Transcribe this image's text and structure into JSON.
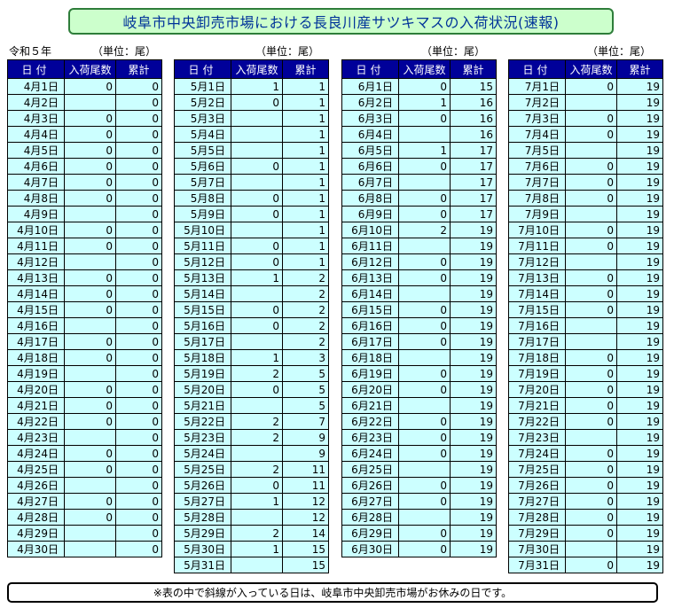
{
  "title": "岐阜市中央卸売市場における長良川産サツキマスの入荷状況(速報)",
  "era": "令和５年",
  "unit_label": "（単位：尾）",
  "headers": {
    "date": "日付",
    "arrivals": "入荷尾数",
    "cumulative": "累計"
  },
  "months": [
    {
      "rows": [
        {
          "date": "4月1日",
          "n": "0",
          "cum": "0"
        },
        {
          "date": "4月2日",
          "n": null,
          "cum": "0"
        },
        {
          "date": "4月3日",
          "n": "0",
          "cum": "0"
        },
        {
          "date": "4月4日",
          "n": "0",
          "cum": "0"
        },
        {
          "date": "4月5日",
          "n": "0",
          "cum": "0"
        },
        {
          "date": "4月6日",
          "n": "0",
          "cum": "0"
        },
        {
          "date": "4月7日",
          "n": "0",
          "cum": "0"
        },
        {
          "date": "4月8日",
          "n": "0",
          "cum": "0"
        },
        {
          "date": "4月9日",
          "n": null,
          "cum": "0"
        },
        {
          "date": "4月10日",
          "n": "0",
          "cum": "0"
        },
        {
          "date": "4月11日",
          "n": "0",
          "cum": "0"
        },
        {
          "date": "4月12日",
          "n": null,
          "cum": "0"
        },
        {
          "date": "4月13日",
          "n": "0",
          "cum": "0"
        },
        {
          "date": "4月14日",
          "n": "0",
          "cum": "0"
        },
        {
          "date": "4月15日",
          "n": "0",
          "cum": "0"
        },
        {
          "date": "4月16日",
          "n": null,
          "cum": "0"
        },
        {
          "date": "4月17日",
          "n": "0",
          "cum": "0"
        },
        {
          "date": "4月18日",
          "n": "0",
          "cum": "0"
        },
        {
          "date": "4月19日",
          "n": null,
          "cum": "0"
        },
        {
          "date": "4月20日",
          "n": "0",
          "cum": "0"
        },
        {
          "date": "4月21日",
          "n": "0",
          "cum": "0"
        },
        {
          "date": "4月22日",
          "n": "0",
          "cum": "0"
        },
        {
          "date": "4月23日",
          "n": "",
          "cum": "0"
        },
        {
          "date": "4月24日",
          "n": "0",
          "cum": "0"
        },
        {
          "date": "4月25日",
          "n": "0",
          "cum": "0"
        },
        {
          "date": "4月26日",
          "n": null,
          "cum": "0"
        },
        {
          "date": "4月27日",
          "n": "0",
          "cum": "0"
        },
        {
          "date": "4月28日",
          "n": "0",
          "cum": "0"
        },
        {
          "date": "4月29日",
          "n": null,
          "cum": "0"
        },
        {
          "date": "4月30日",
          "n": null,
          "cum": "0"
        }
      ]
    },
    {
      "rows": [
        {
          "date": "5月1日",
          "n": "1",
          "cum": "1"
        },
        {
          "date": "5月2日",
          "n": "0",
          "cum": "1"
        },
        {
          "date": "5月3日",
          "n": null,
          "cum": "1"
        },
        {
          "date": "5月4日",
          "n": null,
          "cum": "1"
        },
        {
          "date": "5月5日",
          "n": null,
          "cum": "1"
        },
        {
          "date": "5月6日",
          "n": "0",
          "cum": "1"
        },
        {
          "date": "5月7日",
          "n": null,
          "cum": "1"
        },
        {
          "date": "5月8日",
          "n": "0",
          "cum": "1"
        },
        {
          "date": "5月9日",
          "n": "0",
          "cum": "1"
        },
        {
          "date": "5月10日",
          "n": null,
          "cum": "1"
        },
        {
          "date": "5月11日",
          "n": "0",
          "cum": "1"
        },
        {
          "date": "5月12日",
          "n": "0",
          "cum": "1"
        },
        {
          "date": "5月13日",
          "n": "1",
          "cum": "2"
        },
        {
          "date": "5月14日",
          "n": null,
          "cum": "2"
        },
        {
          "date": "5月15日",
          "n": "0",
          "cum": "2"
        },
        {
          "date": "5月16日",
          "n": "0",
          "cum": "2"
        },
        {
          "date": "5月17日",
          "n": null,
          "cum": "2"
        },
        {
          "date": "5月18日",
          "n": "1",
          "cum": "3"
        },
        {
          "date": "5月19日",
          "n": "2",
          "cum": "5"
        },
        {
          "date": "5月20日",
          "n": "0",
          "cum": "5"
        },
        {
          "date": "5月21日",
          "n": null,
          "cum": "5"
        },
        {
          "date": "5月22日",
          "n": "2",
          "cum": "7"
        },
        {
          "date": "5月23日",
          "n": "2",
          "cum": "9"
        },
        {
          "date": "5月24日",
          "n": null,
          "cum": "9"
        },
        {
          "date": "5月25日",
          "n": "2",
          "cum": "11"
        },
        {
          "date": "5月26日",
          "n": "0",
          "cum": "11"
        },
        {
          "date": "5月27日",
          "n": "1",
          "cum": "12"
        },
        {
          "date": "5月28日",
          "n": null,
          "cum": "12"
        },
        {
          "date": "5月29日",
          "n": "2",
          "cum": "14"
        },
        {
          "date": "5月30日",
          "n": "1",
          "cum": "15"
        },
        {
          "date": "5月31日",
          "n": null,
          "cum": "15"
        }
      ]
    },
    {
      "rows": [
        {
          "date": "6月1日",
          "n": "0",
          "cum": "15"
        },
        {
          "date": "6月2日",
          "n": "1",
          "cum": "16"
        },
        {
          "date": "6月3日",
          "n": "0",
          "cum": "16"
        },
        {
          "date": "6月4日",
          "n": null,
          "cum": "16"
        },
        {
          "date": "6月5日",
          "n": "1",
          "cum": "17"
        },
        {
          "date": "6月6日",
          "n": "0",
          "cum": "17"
        },
        {
          "date": "6月7日",
          "n": null,
          "cum": "17"
        },
        {
          "date": "6月8日",
          "n": "0",
          "cum": "17"
        },
        {
          "date": "6月9日",
          "n": "0",
          "cum": "17"
        },
        {
          "date": "6月10日",
          "n": "2",
          "cum": "19"
        },
        {
          "date": "6月11日",
          "n": null,
          "cum": "19"
        },
        {
          "date": "6月12日",
          "n": "0",
          "cum": "19"
        },
        {
          "date": "6月13日",
          "n": "0",
          "cum": "19"
        },
        {
          "date": "6月14日",
          "n": null,
          "cum": "19"
        },
        {
          "date": "6月15日",
          "n": "0",
          "cum": "19"
        },
        {
          "date": "6月16日",
          "n": "0",
          "cum": "19"
        },
        {
          "date": "6月17日",
          "n": "0",
          "cum": "19"
        },
        {
          "date": "6月18日",
          "n": null,
          "cum": "19"
        },
        {
          "date": "6月19日",
          "n": "0",
          "cum": "19"
        },
        {
          "date": "6月20日",
          "n": "0",
          "cum": "19"
        },
        {
          "date": "6月21日",
          "n": null,
          "cum": "19"
        },
        {
          "date": "6月22日",
          "n": "0",
          "cum": "19"
        },
        {
          "date": "6月23日",
          "n": "0",
          "cum": "19"
        },
        {
          "date": "6月24日",
          "n": "0",
          "cum": "19"
        },
        {
          "date": "6月25日",
          "n": null,
          "cum": "19"
        },
        {
          "date": "6月26日",
          "n": "0",
          "cum": "19"
        },
        {
          "date": "6月27日",
          "n": "0",
          "cum": "19"
        },
        {
          "date": "6月28日",
          "n": null,
          "cum": "19"
        },
        {
          "date": "6月29日",
          "n": "0",
          "cum": "19"
        },
        {
          "date": "6月30日",
          "n": "0",
          "cum": "19"
        }
      ]
    },
    {
      "rows": [
        {
          "date": "7月1日",
          "n": "0",
          "cum": "19"
        },
        {
          "date": "7月2日",
          "n": null,
          "cum": "19"
        },
        {
          "date": "7月3日",
          "n": "0",
          "cum": "19"
        },
        {
          "date": "7月4日",
          "n": "0",
          "cum": "19"
        },
        {
          "date": "7月5日",
          "n": null,
          "cum": "19"
        },
        {
          "date": "7月6日",
          "n": "0",
          "cum": "19"
        },
        {
          "date": "7月7日",
          "n": "0",
          "cum": "19"
        },
        {
          "date": "7月8日",
          "n": "0",
          "cum": "19"
        },
        {
          "date": "7月9日",
          "n": null,
          "cum": "19"
        },
        {
          "date": "7月10日",
          "n": "0",
          "cum": "19"
        },
        {
          "date": "7月11日",
          "n": "0",
          "cum": "19"
        },
        {
          "date": "7月12日",
          "n": null,
          "cum": "19"
        },
        {
          "date": "7月13日",
          "n": "0",
          "cum": "19"
        },
        {
          "date": "7月14日",
          "n": "0",
          "cum": "19"
        },
        {
          "date": "7月15日",
          "n": "0",
          "cum": "19"
        },
        {
          "date": "7月16日",
          "n": null,
          "cum": "19"
        },
        {
          "date": "7月17日",
          "n": null,
          "cum": "19"
        },
        {
          "date": "7月18日",
          "n": "0",
          "cum": "19"
        },
        {
          "date": "7月19日",
          "n": "0",
          "cum": "19"
        },
        {
          "date": "7月20日",
          "n": "0",
          "cum": "19"
        },
        {
          "date": "7月21日",
          "n": "0",
          "cum": "19"
        },
        {
          "date": "7月22日",
          "n": "0",
          "cum": "19"
        },
        {
          "date": "7月23日",
          "n": null,
          "cum": "19"
        },
        {
          "date": "7月24日",
          "n": "0",
          "cum": "19"
        },
        {
          "date": "7月25日",
          "n": "0",
          "cum": "19"
        },
        {
          "date": "7月26日",
          "n": "0",
          "cum": "19"
        },
        {
          "date": "7月27日",
          "n": "0",
          "cum": "19"
        },
        {
          "date": "7月28日",
          "n": "0",
          "cum": "19"
        },
        {
          "date": "7月29日",
          "n": "0",
          "cum": "19"
        },
        {
          "date": "7月30日",
          "n": null,
          "cum": "19"
        },
        {
          "date": "7月31日",
          "n": "0",
          "cum": "19"
        }
      ]
    }
  ],
  "note": "※表の中で斜線が入っている日は、岐阜市中央卸売市場がお休みの日です。"
}
